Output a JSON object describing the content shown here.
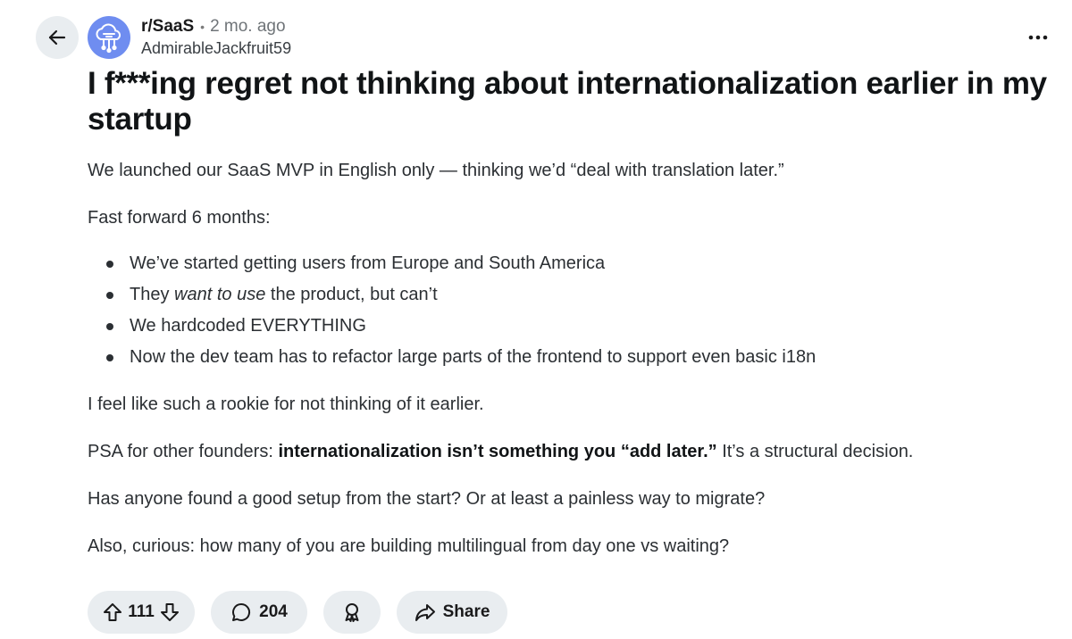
{
  "post": {
    "subreddit": "r/SaaS",
    "separator": "•",
    "age": "2 mo. ago",
    "author": "AdmirableJackfruit59",
    "title": "I f***ing regret not thinking about internationalization earlier in my startup",
    "body": {
      "intro": "We launched our SaaS MVP in English only — thinking we’d “deal with translation later.”",
      "lead": "Fast forward 6 months:",
      "bullets": {
        "b1": "We’ve started getting users from Europe and South America",
        "b2_pre": "They ",
        "b2_em": "want to use",
        "b2_post": " the product, but can’t",
        "b3": "We hardcoded EVERYTHING",
        "b4": "Now the dev team has to refactor large parts of the frontend to support even basic i18n"
      },
      "reflection": "I feel like such a rookie for not thinking of it earlier.",
      "psa_pre": "PSA for other founders: ",
      "psa_bold": "internationalization isn’t something you “add later.”",
      "psa_post": " It’s a structural decision.",
      "question1": "Has anyone found a good setup from the start? Or at least a painless way to migrate?",
      "question2": "Also, curious: how many of you are building multilingual from day one vs waiting?"
    }
  },
  "actions": {
    "score": "111",
    "comments": "204",
    "share_label": "Share"
  },
  "icons": {
    "back": "arrow-left-icon",
    "avatar": "cloud-network-icon",
    "more": "more-horizontal-icon",
    "upvote": "arrow-up-icon",
    "downvote": "arrow-down-icon",
    "comment": "speech-bubble-icon",
    "award": "award-ribbon-icon",
    "share": "share-arrow-icon"
  },
  "colors": {
    "avatar_bg": "#6f8df0",
    "button_bg": "#e9edf0",
    "text": "#1a1a1b"
  }
}
